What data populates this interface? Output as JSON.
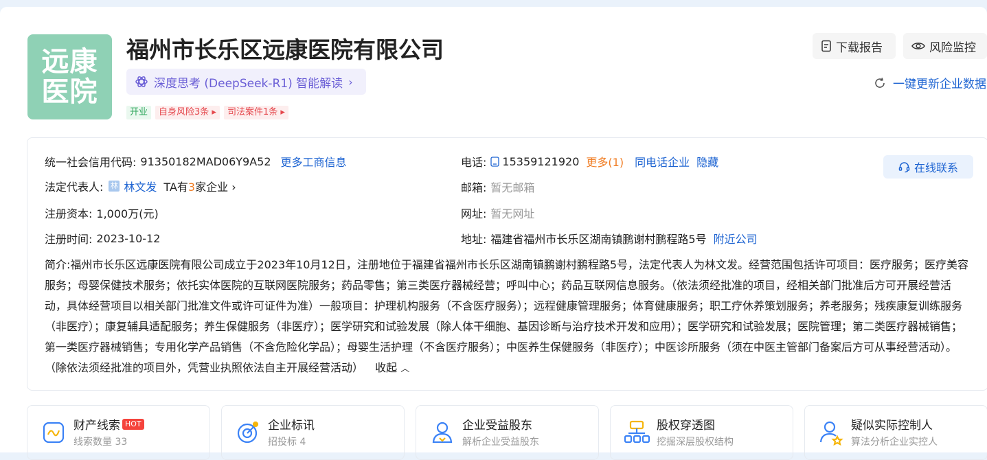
{
  "company": {
    "logo_line1": "远康",
    "logo_line2": "医院",
    "name": "福州市长乐区远康医院有限公司",
    "ai_label": "深度思考 (DeepSeek-R1) 智能解读",
    "tags": [
      {
        "label": "开业",
        "color": "#2fa65b"
      },
      {
        "label": "自身风险3条",
        "color": "#e5484d"
      },
      {
        "label": "司法案件1条",
        "color": "#e5484d"
      }
    ]
  },
  "actions": {
    "download": "下载报告",
    "monitor": "风险监控",
    "refresh": "一键更新企业数据"
  },
  "info": {
    "credit_label": "统一社会信用代码:",
    "credit_value": "91350182MAD06Y9A52",
    "more_business": "更多工商信息",
    "legal_label": "法定代表人:",
    "legal_avatar": "林",
    "legal_name": "林文发",
    "ta_prefix": "TA有",
    "ta_count": "3",
    "ta_suffix": "家企业",
    "capital_label": "注册资本:",
    "capital_value": "1,000万(元)",
    "date_label": "注册时间:",
    "date_value": "2023-10-12",
    "phone_label": "电话:",
    "phone_value": "15359121920",
    "phone_more": "更多(1)",
    "same_phone": "同电话企业",
    "hide": "隐藏",
    "email_label": "邮箱:",
    "email_value": "暂无邮箱",
    "web_label": "网址:",
    "web_value": "暂无网址",
    "addr_label": "地址:",
    "addr_value": "福建省福州市长乐区湖南镇鹏谢村鹏程路5号",
    "nearby": "附近公司",
    "online": "在线联系",
    "desc_label": "简介:",
    "desc_text": "福州市长乐区远康医院有限公司成立于2023年10月12日，注册地位于福建省福州市长乐区湖南镇鹏谢村鹏程路5号，法定代表人为林文发。经营范围包括许可项目：医疗服务；医疗美容服务；母婴保健技术服务；依托实体医院的互联网医院服务；药品零售；第三类医疗器械经营；呼叫中心；药品互联网信息服务。（依法须经批准的项目，经相关部门批准后方可开展经营活动，具体经营项目以相关部门批准文件或许可证件为准）一般项目：护理机构服务（不含医疗服务）；远程健康管理服务；体育健康服务；职工疗休养策划服务；养老服务；残疾康复训练服务（非医疗）；康复辅具适配服务；养生保健服务（非医疗）；医学研究和试验发展（除人体干细胞、基因诊断与治疗技术开发和应用）；医学研究和试验发展；医院管理；第二类医疗器械销售；第一类医疗器械销售；专用化学产品销售（不含危险化学品）；母婴生活护理（不含医疗服务）；中医养生保健服务（非医疗）；中医诊所服务（须在中医主管部门备案后方可从事经营活动）。（除依法须经批准的项目外，凭营业执照依法自主开展经营活动）",
    "collapse": "收起"
  },
  "features": [
    {
      "title": "财产线索",
      "hot": "HOT",
      "sub": "线索数量 33",
      "icon": "property-clue-icon"
    },
    {
      "title": "企业标讯",
      "hot": "",
      "sub": "招投标 4",
      "icon": "bidding-icon"
    },
    {
      "title": "企业受益股东",
      "hot": "",
      "sub": "解析企业受益股东",
      "icon": "beneficiary-icon"
    },
    {
      "title": "股权穿透图",
      "hot": "",
      "sub": "挖掘深层股权结构",
      "icon": "equity-chart-icon"
    },
    {
      "title": "疑似实际控制人",
      "hot": "",
      "sub": "算法分析企业实控人",
      "icon": "controller-icon"
    }
  ]
}
